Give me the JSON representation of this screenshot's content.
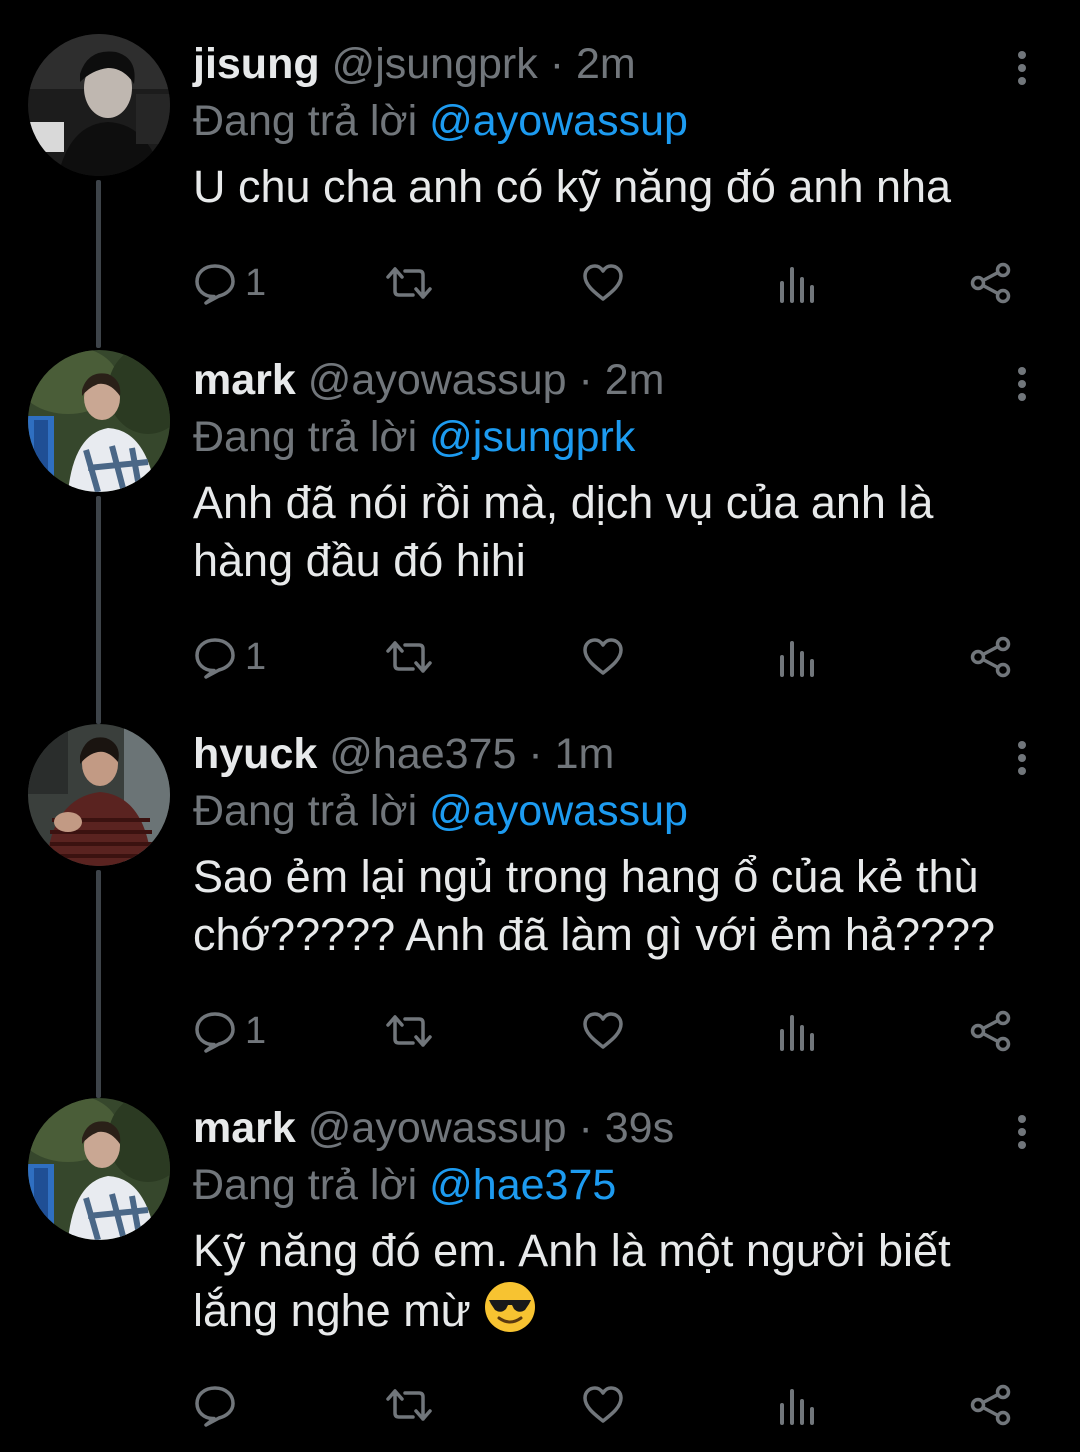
{
  "reply_prefix": "Đang trả lời",
  "colors": {
    "background": "#000000",
    "text": "#e7e9ea",
    "muted": "#71767b",
    "mention": "#1d9bf0",
    "thread_line": "#3d4349"
  },
  "tweets": [
    {
      "name": "jisung",
      "handle": "@jsungprk",
      "separator": "·",
      "time": "2m",
      "replying_to": "@ayowassup",
      "text": "U chu cha anh có kỹ năng đó anh nha",
      "text_emoji": "",
      "reply_count": "1",
      "icons": [
        "reply-icon",
        "retweet-icon",
        "like-icon",
        "views-icon",
        "share-icon",
        "more-icon"
      ]
    },
    {
      "name": "mark",
      "handle": "@ayowassup",
      "separator": "·",
      "time": "2m",
      "replying_to": "@jsungprk",
      "text": "Anh đã nói rồi mà, dịch vụ của anh là hàng đầu đó hihi",
      "text_emoji": "",
      "reply_count": "1",
      "icons": [
        "reply-icon",
        "retweet-icon",
        "like-icon",
        "views-icon",
        "share-icon",
        "more-icon"
      ]
    },
    {
      "name": "hyuck",
      "handle": "@hae375",
      "separator": "·",
      "time": "1m",
      "replying_to": "@ayowassup",
      "text": "Sao ẻm lại ngủ trong hang ổ của kẻ thù chớ????? Anh đã làm gì với ẻm hả????",
      "text_emoji": "",
      "reply_count": "1",
      "icons": [
        "reply-icon",
        "retweet-icon",
        "like-icon",
        "views-icon",
        "share-icon",
        "more-icon"
      ]
    },
    {
      "name": "mark",
      "handle": "@ayowassup",
      "separator": "·",
      "time": "39s",
      "replying_to": "@hae375",
      "text": "Kỹ năng đó em. Anh là một người biết lắng nghe mừ",
      "text_emoji": "sunglasses-emoji",
      "reply_count": "",
      "icons": [
        "reply-icon",
        "retweet-icon",
        "like-icon",
        "views-icon",
        "share-icon",
        "more-icon"
      ]
    }
  ]
}
